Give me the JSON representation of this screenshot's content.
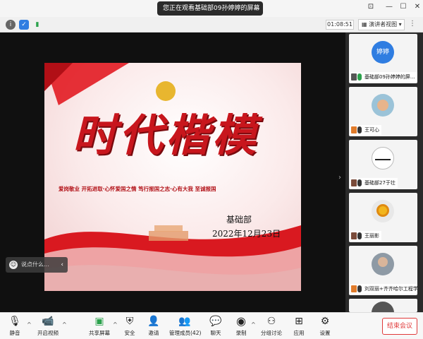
{
  "window": {
    "title": "您正在观看基础部09孙婷婷的屏幕",
    "title_chevron": "⌄"
  },
  "window_controls": {
    "pin": "⊡",
    "minimize": "—",
    "maximize": "☐",
    "close": "✕"
  },
  "infobar": {
    "timer": "01:08:51",
    "view_label": "演讲者视图",
    "more": "⋮",
    "view_caret": "▾"
  },
  "slide": {
    "title": "时代楷模",
    "slogan": "爱岗敬业 开拓进取·心怀爱国之情 笃行报国之志·心有大我 至诚报国",
    "department": "基础部",
    "date": "2022年12月23日"
  },
  "comment_box": {
    "placeholder": "说点什么...",
    "arrow": "‹"
  },
  "panel_arrow": "›",
  "participants": [
    {
      "name": "基础部09孙婷婷的屏...",
      "avatar_text": "婷婷",
      "mic_on": true
    },
    {
      "name": "王可心",
      "avatar_text": "",
      "mic_on": false
    },
    {
      "name": "基础部27于壮",
      "avatar_text": "",
      "mic_on": false
    },
    {
      "name": "王丽影",
      "avatar_text": "",
      "mic_on": false
    },
    {
      "name": "刘双丽+齐齐哈尔工程学院",
      "avatar_text": "",
      "mic_on": false
    },
    {
      "name": "",
      "avatar_text": "",
      "mic_on": false
    }
  ],
  "toolbar": {
    "mute": "静音",
    "video": "开启视频",
    "share": "共享屏幕",
    "security": "安全",
    "invite": "邀请",
    "manage": "管理成员(42)",
    "chat": "聊天",
    "record": "录制",
    "breakout": "分组讨论",
    "apps": "应用",
    "settings": "设置",
    "end": "结束会议",
    "caret": "^"
  },
  "colors": {
    "accent_red": "#c8161d",
    "end_red": "#e03a3a",
    "mic_green": "#2ba24c"
  },
  "icons": [
    "info-icon",
    "shield-icon",
    "signal-icon",
    "microphone-icon",
    "video-camera-icon",
    "share-screen-icon",
    "security-shield-icon",
    "invite-icon",
    "members-icon",
    "chat-icon",
    "record-icon",
    "breakout-icon",
    "apps-icon",
    "settings-gear-icon",
    "emoji-icon",
    "chevron-left-icon",
    "chevron-right-icon"
  ]
}
